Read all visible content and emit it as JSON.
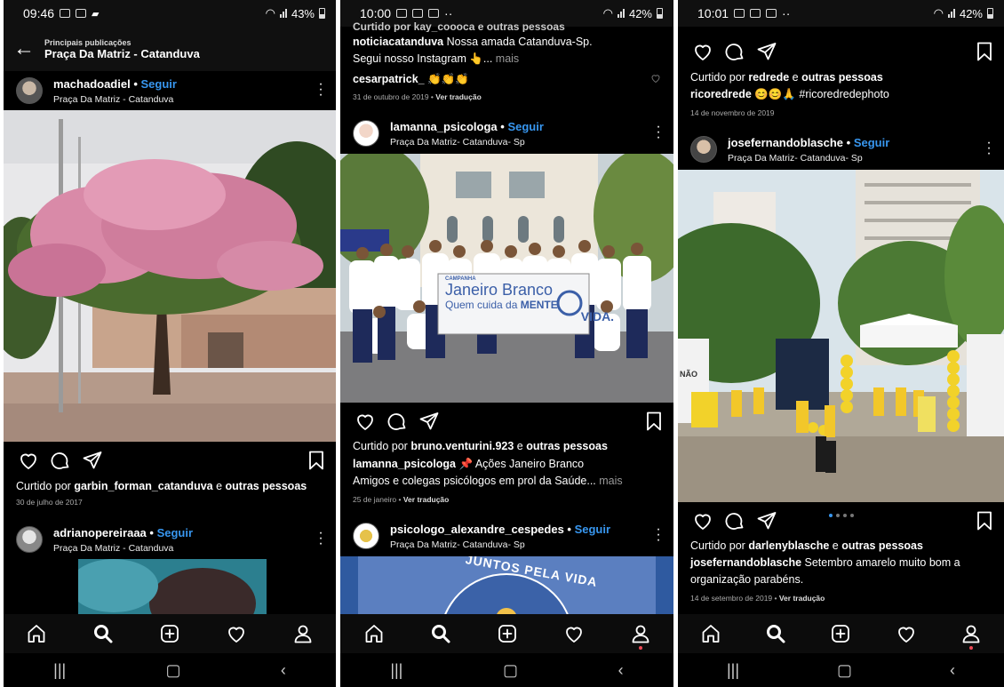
{
  "panels": {
    "p1": {
      "status": {
        "time": "09:46",
        "battery": "43%"
      },
      "header": {
        "small": "Principais publicações",
        "title": "Praça Da Matriz - Catanduva"
      },
      "post1": {
        "user": "machadoadiel",
        "follow": "Seguir",
        "location": "Praça Da Matriz - Catanduva",
        "liked_prefix": "Curtido por ",
        "liked_user": "garbin_forman_catanduva",
        "liked_mid": " e ",
        "liked_others": "outras pessoas",
        "date": "30 de julho de 2017"
      },
      "post2": {
        "user": "adrianopereiraaa",
        "follow": "Seguir",
        "location": "Praça Da Matriz - Catanduva"
      }
    },
    "p2": {
      "status": {
        "time": "10:00",
        "battery": "42%"
      },
      "top": {
        "cut_line": "Curtido por kay_coooca e outras pessoas",
        "user1": "noticiacatanduva",
        "text1": " Nossa amada Catanduva-Sp.",
        "line2": "Segui nosso Instagram 👆... ",
        "mais": "mais",
        "commenter": "cesarpatrick_",
        "comment": " 👏👏👏",
        "date": "31 de outubro de 2019",
        "translate": "Ver tradução"
      },
      "post1": {
        "user": "lamanna_psicologa",
        "follow": "Seguir",
        "location": "Praça Da Matriz- Catanduva- Sp",
        "liked_prefix": "Curtido por ",
        "liked_user": "bruno.venturini.923",
        "liked_mid": " e ",
        "liked_others": "outras pessoas",
        "cap_user": "lamanna_psicologa",
        "cap_text": " 📌 Ações Janeiro Branco",
        "cap_line2": "Amigos e colegas psicólogos em prol da Saúde... ",
        "mais": "mais",
        "date": "25 de janeiro",
        "translate": "Ver tradução",
        "banner_small": "CAMPANHA",
        "banner_title": "Janeiro Branco",
        "banner_sub": "Quem cuida da",
        "banner_mente": "MENTE,",
        "banner_vida": "VIDA."
      },
      "post2": {
        "user": "psicologo_alexandre_cespedes",
        "follow": "Seguir",
        "location": "Praça Da Matriz- Catanduva- Sp",
        "banner": "JUNTOS PELA VIDA"
      }
    },
    "p3": {
      "status": {
        "time": "10:01",
        "battery": "42%"
      },
      "top": {
        "liked_prefix": "Curtido por ",
        "liked_user": "redrede",
        "liked_mid": " e ",
        "liked_others": "outras pessoas",
        "cap_user": "ricoredrede",
        "cap_text": " 😊😊🙏 #ricoredredephoto",
        "date": "14 de novembro de 2019"
      },
      "post1": {
        "user": "josefernandoblasche",
        "follow": "Seguir",
        "location": "Praça Da Matriz- Catanduva- Sp",
        "liked_prefix": "Curtido por ",
        "liked_user": "darlenyblasche",
        "liked_mid": " e ",
        "liked_others": "outras pessoas",
        "cap_user": "josefernandoblasche",
        "cap_text": " Setembro amarelo muito bom a",
        "cap_line2": "organização parabéns.",
        "date": "14 de setembro de 2019",
        "translate": "Ver tradução",
        "sign": "NÃO"
      }
    }
  },
  "colors": {
    "link": "#3897f0",
    "background": "#000000",
    "notification": "#ed4956"
  },
  "icons": [
    "home-icon",
    "search-icon",
    "add-post-icon",
    "heart-icon",
    "profile-icon",
    "like-icon",
    "comment-icon",
    "share-icon",
    "bookmark-icon"
  ]
}
